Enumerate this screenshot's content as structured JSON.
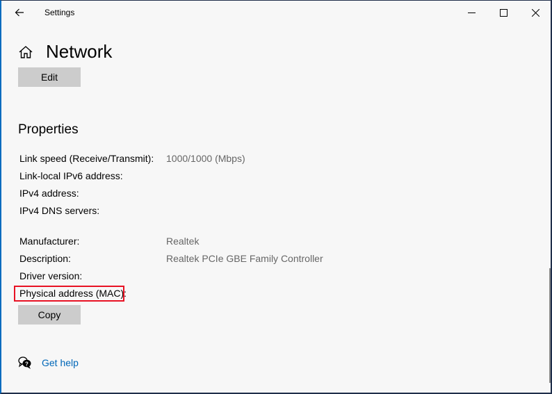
{
  "window": {
    "app_title": "Settings",
    "controls": {
      "minimize": "minimize",
      "maximize": "maximize",
      "close": "close"
    }
  },
  "header": {
    "title": "Network",
    "edit_label": "Edit"
  },
  "properties": {
    "title": "Properties",
    "rows": [
      {
        "label": "Link speed (Receive/Transmit):",
        "value": "1000/1000 (Mbps)"
      },
      {
        "label": "Link-local IPv6 address:",
        "value": ""
      },
      {
        "label": "IPv4 address:",
        "value": ""
      },
      {
        "label": "IPv4 DNS servers:",
        "value": ""
      },
      {
        "label": "Manufacturer:",
        "value": "Realtek"
      },
      {
        "label": "Description:",
        "value": "Realtek PCIe GBE Family Controller"
      },
      {
        "label": "Driver version:",
        "value": ""
      },
      {
        "label": "Physical address (MAC):",
        "value": ""
      }
    ],
    "copy_label": "Copy"
  },
  "help": {
    "label": "Get help"
  },
  "colors": {
    "highlight": "#e81123",
    "link": "#0067b8",
    "button": "#cccccc"
  }
}
